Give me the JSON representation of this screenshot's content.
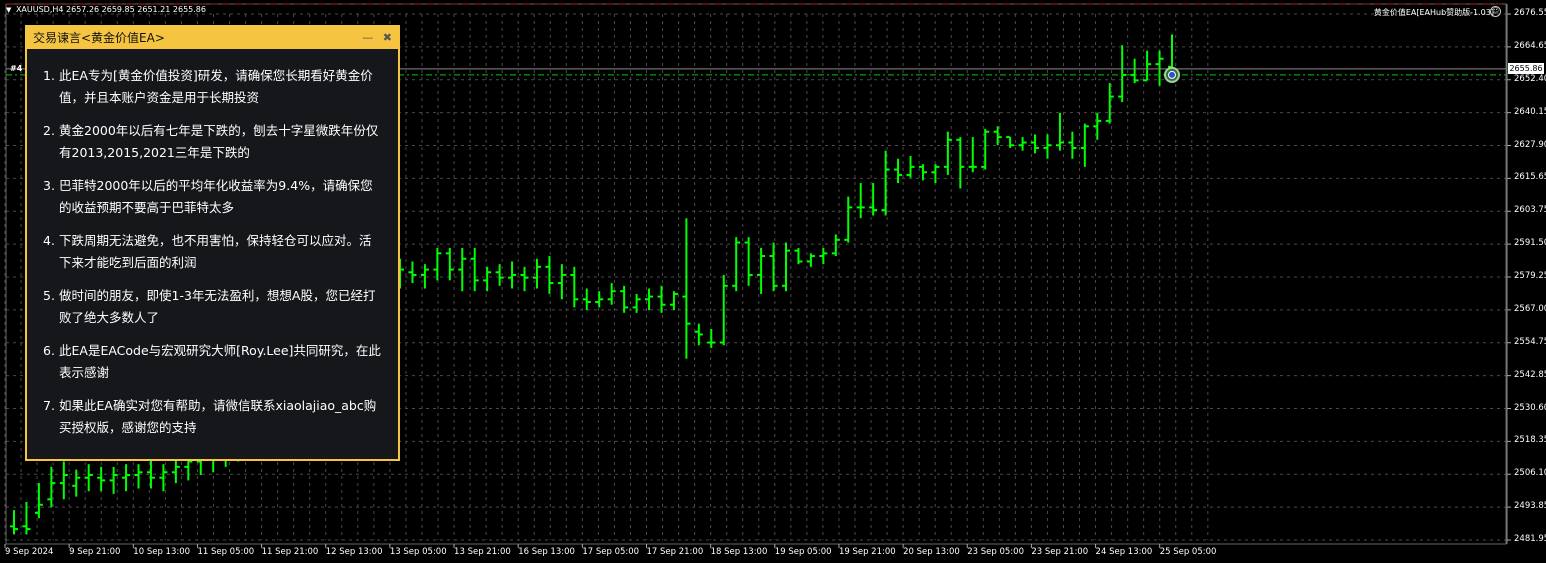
{
  "header": {
    "symbol_info": "XAUUSD,H4  2657.26 2659.85 2651.21 2655.86",
    "ea_name": "黄金价值EA[EAHub赞助版-1.03]"
  },
  "order_tag": "#4",
  "current_price_tag": "2655.86",
  "panel": {
    "title": "交易谏言<黄金价值EA>",
    "minimize_icon": "minimize-icon",
    "close_icon": "close-icon",
    "items": [
      {
        "num": "1.",
        "text": "此EA专为[黄金价值投资]研发，请确保您长期看好黄金价值，并且本账户资金是用于长期投资"
      },
      {
        "num": "2.",
        "text": "黄金2000年以后有七年是下跌的，刨去十字星微跌年份仅有2013,2015,2021三年是下跌的"
      },
      {
        "num": "3.",
        "text": "巴菲特2000年以后的平均年化收益率为9.4%，请确保您的收益预期不要高于巴菲特太多"
      },
      {
        "num": "4.",
        "text": "下跌周期无法避免，也不用害怕，保持轻仓可以应对。活下来才能吃到后面的利润"
      },
      {
        "num": "5.",
        "text": "做时间的朋友，即使1-3年无法盈利，想想A股，您已经打败了绝大多数人了"
      },
      {
        "num": "6.",
        "text": "此EA是EACode与宏观研究大师[Roy.Lee]共同研究，在此表示感谢"
      },
      {
        "num": "7.",
        "text": "如果此EA确实对您有帮助，请微信联系xiaolajiao_abc购买授权版，感谢您的支持"
      }
    ]
  },
  "y_axis": [
    "2676.55",
    "2664.65",
    "2652.40",
    "2640.15",
    "2627.90",
    "2615.65",
    "2603.75",
    "2591.50",
    "2579.25",
    "2567.00",
    "2554.75",
    "2542.85",
    "2530.60",
    "2518.35",
    "2506.10",
    "2493.85",
    "2481.95"
  ],
  "x_axis": [
    "9 Sep 2024",
    "9 Sep 21:00",
    "10 Sep 13:00",
    "11 Sep 05:00",
    "11 Sep 21:00",
    "12 Sep 13:00",
    "13 Sep 05:00",
    "13 Sep 21:00",
    "16 Sep 13:00",
    "17 Sep 05:00",
    "17 Sep 21:00",
    "18 Sep 13:00",
    "19 Sep 05:00",
    "19 Sep 21:00",
    "20 Sep 13:00",
    "23 Sep 05:00",
    "23 Sep 21:00",
    "24 Sep 13:00",
    "25 Sep 05:00"
  ],
  "colors": {
    "background": "#000000",
    "bars": "#00ff00",
    "grid": "#4a4a4a",
    "panel_border": "#f5c542",
    "bid_line": "#00c800"
  },
  "chart_data": {
    "type": "ohlc",
    "ylim": [
      2481.95,
      2676.55
    ],
    "current_price": 2655.86,
    "bars": [
      [
        2487,
        2493,
        2484,
        2486
      ],
      [
        2487,
        2496,
        2484,
        2486
      ],
      [
        2492,
        2503,
        2490,
        2495
      ],
      [
        2497,
        2509,
        2494,
        2503
      ],
      [
        2503,
        2511,
        2497,
        2506
      ],
      [
        2502,
        2508,
        2498,
        2505
      ],
      [
        2505,
        2510,
        2500,
        2506
      ],
      [
        2505,
        2509,
        2500,
        2504
      ],
      [
        2504,
        2509,
        2499,
        2506
      ],
      [
        2505,
        2510,
        2500,
        2506
      ],
      [
        2506,
        2510,
        2501,
        2507
      ],
      [
        2507,
        2512,
        2501,
        2505
      ],
      [
        2505,
        2510,
        2500,
        2507
      ],
      [
        2507,
        2513,
        2503,
        2509
      ],
      [
        2509,
        2514,
        2504,
        2511
      ],
      [
        2511,
        2516,
        2506,
        2512
      ],
      [
        2512,
        2518,
        2507,
        2514
      ],
      [
        2514,
        2520,
        2509,
        2516
      ],
      [
        2516,
        2521,
        2511,
        2517
      ],
      [
        2517,
        2523,
        2512,
        2519
      ],
      [
        2519,
        2524,
        2513,
        2520
      ],
      [
        2520,
        2526,
        2515,
        2522
      ],
      [
        2522,
        2527,
        2516,
        2523
      ],
      [
        2523,
        2529,
        2518,
        2525
      ],
      [
        2525,
        2531,
        2519,
        2527
      ],
      [
        2527,
        2532,
        2521,
        2528
      ],
      [
        2528,
        2533,
        2522,
        2530
      ],
      [
        2530,
        2535,
        2524,
        2532
      ],
      [
        2566,
        2575,
        2563,
        2569
      ],
      [
        2569,
        2583,
        2566,
        2577
      ],
      [
        2577,
        2584,
        2572,
        2578
      ],
      [
        2578,
        2586,
        2575,
        2582
      ],
      [
        2581,
        2585,
        2577,
        2580
      ],
      [
        2580,
        2584,
        2575,
        2582
      ],
      [
        2582,
        2590,
        2578,
        2588
      ],
      [
        2588,
        2590,
        2578,
        2582
      ],
      [
        2582,
        2590,
        2574,
        2586
      ],
      [
        2586,
        2590,
        2574,
        2578
      ],
      [
        2578,
        2583,
        2574,
        2581
      ],
      [
        2581,
        2584,
        2576,
        2579
      ],
      [
        2579,
        2585,
        2575,
        2580
      ],
      [
        2580,
        2583,
        2574,
        2579
      ],
      [
        2579,
        2586,
        2575,
        2583
      ],
      [
        2583,
        2587,
        2573,
        2577
      ],
      [
        2577,
        2584,
        2571,
        2580
      ],
      [
        2580,
        2583,
        2568,
        2571
      ],
      [
        2571,
        2575,
        2567,
        2570
      ],
      [
        2570,
        2574,
        2568,
        2571
      ],
      [
        2571,
        2577,
        2569,
        2574
      ],
      [
        2574,
        2576,
        2566,
        2568
      ],
      [
        2568,
        2573,
        2566,
        2571
      ],
      [
        2571,
        2575,
        2567,
        2572
      ],
      [
        2572,
        2576,
        2566,
        2569
      ],
      [
        2569,
        2574,
        2567,
        2573
      ],
      [
        2572,
        2601,
        2549,
        2562
      ],
      [
        2559,
        2562,
        2554,
        2558
      ],
      [
        2555,
        2560,
        2553,
        2555
      ],
      [
        2555,
        2580,
        2554,
        2576
      ],
      [
        2576,
        2594,
        2574,
        2592
      ],
      [
        2592,
        2594,
        2576,
        2580
      ],
      [
        2580,
        2590,
        2573,
        2587
      ],
      [
        2587,
        2592,
        2574,
        2576
      ],
      [
        2576,
        2592,
        2574,
        2589
      ],
      [
        2589,
        2590,
        2584,
        2585
      ],
      [
        2585,
        2588,
        2583,
        2587
      ],
      [
        2587,
        2590,
        2584,
        2588
      ],
      [
        2588,
        2595,
        2587,
        2593
      ],
      [
        2593,
        2609,
        2592,
        2605
      ],
      [
        2605,
        2614,
        2601,
        2605
      ],
      [
        2605,
        2614,
        2602,
        2604
      ],
      [
        2604,
        2626,
        2602,
        2619
      ],
      [
        2619,
        2623,
        2614,
        2617
      ],
      [
        2617,
        2624,
        2616,
        2620
      ],
      [
        2620,
        2621,
        2615,
        2618
      ],
      [
        2618,
        2621,
        2614,
        2620
      ],
      [
        2620,
        2633,
        2617,
        2630
      ],
      [
        2630,
        2631,
        2612,
        2620
      ],
      [
        2620,
        2631,
        2618,
        2620
      ],
      [
        2620,
        2634,
        2619,
        2633
      ],
      [
        2633,
        2635,
        2628,
        2631
      ],
      [
        2631,
        2631,
        2627,
        2628
      ],
      [
        2628,
        2631,
        2626,
        2629
      ],
      [
        2629,
        2632,
        2625,
        2627
      ],
      [
        2627,
        2632,
        2623,
        2628
      ],
      [
        2628,
        2640,
        2626,
        2629
      ],
      [
        2629,
        2633,
        2623,
        2627
      ],
      [
        2627,
        2636,
        2620,
        2635
      ],
      [
        2635,
        2640,
        2630,
        2637
      ],
      [
        2637,
        2651,
        2636,
        2646
      ],
      [
        2646,
        2665,
        2644,
        2654
      ],
      [
        2654,
        2660,
        2651,
        2652
      ],
      [
        2652,
        2663,
        2652,
        2658
      ],
      [
        2658,
        2663,
        2650,
        2660
      ],
      [
        2657,
        2669,
        2652,
        2656
      ]
    ]
  }
}
